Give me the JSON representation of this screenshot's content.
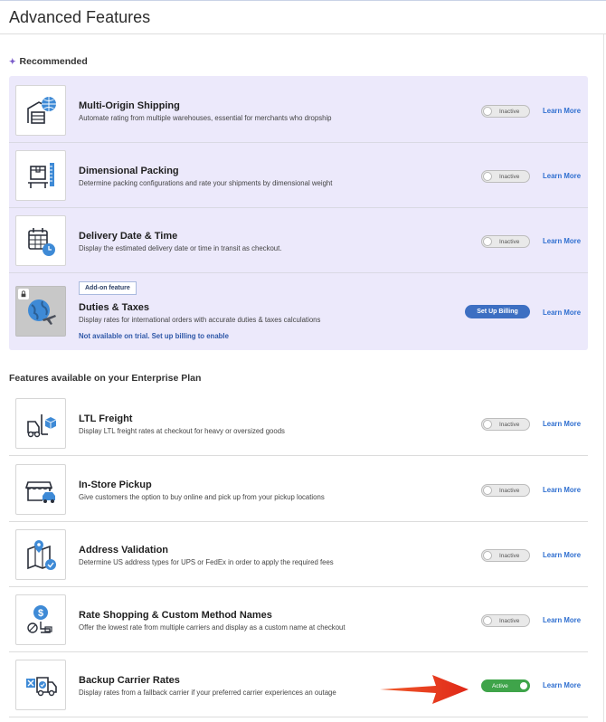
{
  "page": {
    "title": "Advanced Features"
  },
  "sections": {
    "recommended": "Recommended",
    "enterprise": "Features available on your Enterprise Plan"
  },
  "colors": {
    "accent": "#2f6fd0",
    "recommended_bg": "#ece9fb",
    "active": "#3fa44a",
    "billing_button": "#3d6fc2",
    "arrow": "#e8341f"
  },
  "learn_more_label": "Learn More",
  "features": [
    {
      "title": "Multi-Origin Shipping",
      "description": "Automate rating from multiple warehouses, essential for merchants who dropship",
      "status": "Inactive",
      "icon": "warehouse-globe-icon"
    },
    {
      "title": "Dimensional Packing",
      "description": "Determine packing configurations and rate your shipments by dimensional weight",
      "status": "Inactive",
      "icon": "package-ruler-icon"
    },
    {
      "title": "Delivery Date & Time",
      "description": "Display the estimated delivery date or time in transit as checkout.",
      "status": "Inactive",
      "icon": "calendar-clock-icon"
    },
    {
      "title": "Duties & Taxes",
      "description": "Display rates for international orders with accurate duties & taxes calculations",
      "badge": "Add-on feature",
      "button": "Set Up Billing",
      "note": "Not available on trial. Set up billing to enable",
      "icon": "globe-plane-icon"
    },
    {
      "title": "LTL Freight",
      "description": "Display LTL freight rates at checkout for heavy or oversized goods",
      "status": "Inactive",
      "icon": "forklift-icon"
    },
    {
      "title": "In-Store Pickup",
      "description": "Give customers the option to buy online and pick up from your pickup locations",
      "status": "Inactive",
      "icon": "store-car-icon"
    },
    {
      "title": "Address Validation",
      "description": "Determine US address types for UPS or FedEx in order to apply the required fees",
      "status": "Inactive",
      "icon": "map-check-icon"
    },
    {
      "title": "Rate Shopping & Custom Method Names",
      "description": "Offer the lowest rate from multiple carriers and display as a custom name at checkout",
      "status": "Inactive",
      "icon": "dollar-hand-icon"
    },
    {
      "title": "Backup Carrier Rates",
      "description": "Display rates from a fallback carrier if your preferred carrier experiences an outage",
      "status": "Active",
      "icon": "truck-backup-icon"
    }
  ]
}
